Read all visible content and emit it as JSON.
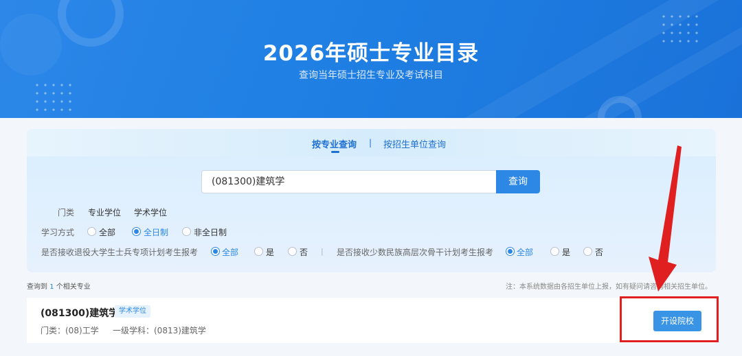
{
  "banner": {
    "title": "2026年硕士专业目录",
    "subtitle": "查询当年硕士招生专业及考试科目"
  },
  "tabs": {
    "major": "按专业查询",
    "separator": "|",
    "unit": "按招生单位查询"
  },
  "search": {
    "value": "(081300)建筑学",
    "button": "查询"
  },
  "filters": {
    "category": {
      "label": "门类",
      "options": [
        "专业学位",
        "学术学位"
      ]
    },
    "study_mode": {
      "label": "学习方式",
      "options": [
        "全部",
        "全日制",
        "非全日制"
      ],
      "selected": "全日制"
    },
    "veteran_plan": {
      "label": "是否接收退役大学生士兵专项计划考生报考",
      "options": [
        "全部",
        "是",
        "否"
      ],
      "selected": "全部"
    },
    "separator": "|",
    "minority_plan": {
      "label": "是否接收少数民族高层次骨干计划考生报考",
      "options": [
        "全部",
        "是",
        "否"
      ],
      "selected": "全部"
    }
  },
  "results": {
    "prefix": "查询到",
    "count": "1",
    "suffix": "个相关专业",
    "note": "注：本系统数据由各招生单位上报，如有疑问请咨询相关招生单位。",
    "items": [
      {
        "name": "(081300)建筑学",
        "badge": "学术学位",
        "category": "门类：(08)工学",
        "discipline": "一级学科：(0813)建筑学",
        "button": "开设院校"
      }
    ]
  },
  "colors": {
    "brand_blue": "#2c88e4",
    "banner_blue": "#1f7fe3",
    "annotation_red": "#e02020"
  }
}
